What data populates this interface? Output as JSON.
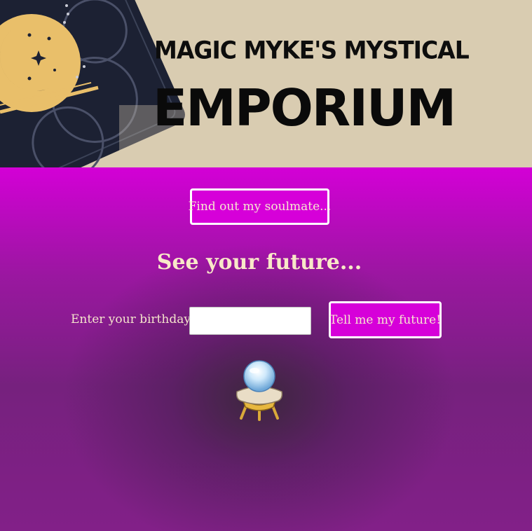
{
  "header": {
    "title_line1": "MAGIC MYKE'S MYSTICAL",
    "title_line2": "EMPORIUM",
    "banner_icon": "tarot-card-moon-icon"
  },
  "main": {
    "soulmate_button_label": "Find out my soulmate...",
    "heading": "See your future...",
    "birthday_label": "Enter your birthday:",
    "birthday_value": "",
    "birthday_placeholder": "",
    "future_button_label": "Tell me my future!",
    "crystal_ball_icon": "crystal-ball-icon"
  },
  "colors": {
    "banner_bg": "#d9ccb1",
    "main_top": "#d300d6",
    "main_mid": "#76217e",
    "button_bg": "#d600d9",
    "button_border": "#ffffff",
    "text_cream": "#f7e7d0"
  }
}
